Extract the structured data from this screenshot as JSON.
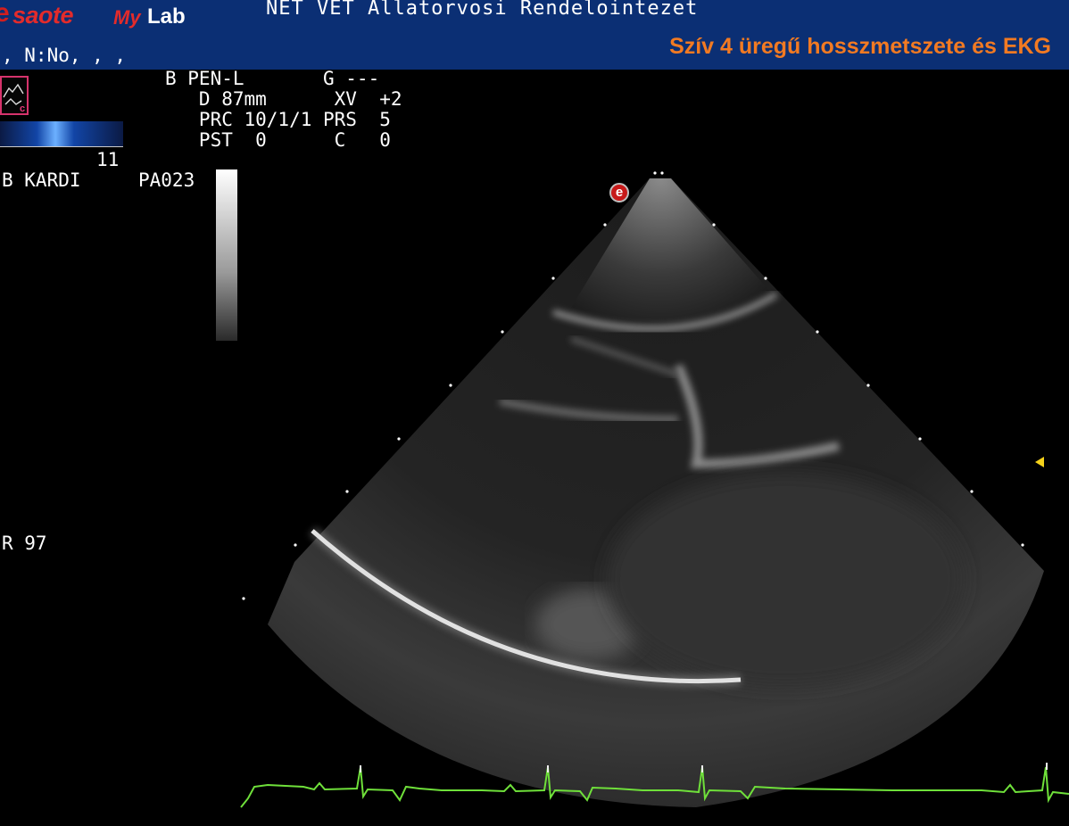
{
  "header": {
    "brand_e": "e",
    "brand_saote": "saote",
    "brand_my": "My",
    "brand_lab": "Lab",
    "clinic_name": "NET VET Állatorvosi Rendelointezet",
    "patient_info": ", N:No, , ,",
    "overlay_title": "Szív 4 üregű hosszmetszete és EKG"
  },
  "params": {
    "row1": "B PEN-L       G ---",
    "row2": "   D 87mm      XV  +2",
    "row3": "   PRC 10/1/1 PRS  5",
    "row4": "   PST  0      C   0"
  },
  "left_panel": {
    "color_scale_value": "11",
    "mode_label": "B KARDI",
    "preset_label": "PA023",
    "heart_rate": "R 97"
  },
  "scan_icon_letter": "e",
  "colors": {
    "header_bg": "#0b2f74",
    "title_orange": "#f27a22",
    "ekg_green": "#6fe03a",
    "marker_yellow": "#f5d21b",
    "brand_red": "#e32b2b"
  }
}
